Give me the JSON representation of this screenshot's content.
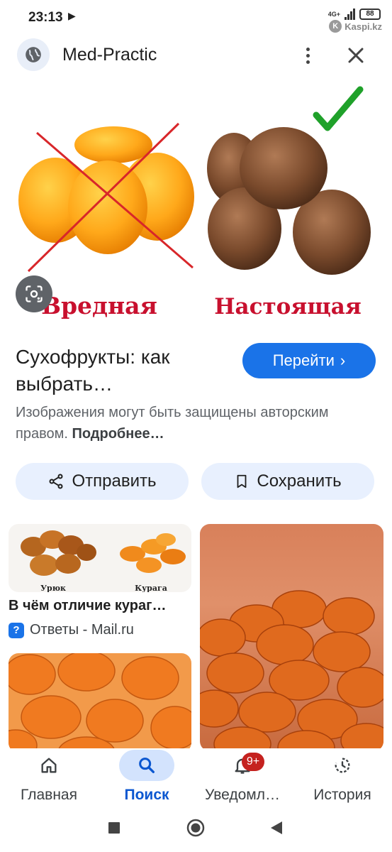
{
  "status_bar": {
    "time": "23:13",
    "network": "4G+",
    "battery": "88",
    "watermark": "Kaspi.kz"
  },
  "header": {
    "site_name": "Med-Practic",
    "site_icon": "globe-icon",
    "more_icon": "more-vert-icon",
    "close_icon": "close-icon"
  },
  "main_image": {
    "left_label": "Вредная",
    "right_label": "Настоящая"
  },
  "result": {
    "title_line1": "Сухофрукты: как",
    "title_line2": "выбрать…",
    "visit_label": "Перейти",
    "copyright_text": "Изображения могут быть защищены авторским правом.",
    "copyright_link": "Подробнее…"
  },
  "actions": {
    "share_label": "Отправить",
    "save_label": "Сохранить"
  },
  "related": {
    "card1": {
      "left_caption": "Урюк",
      "right_caption": "Курага",
      "title": "В чём отличие кураг…",
      "source": "Ответы - Mail.ru"
    }
  },
  "bottom_nav": {
    "items": [
      {
        "label": "Главная",
        "icon": "home-icon"
      },
      {
        "label": "Поиск",
        "icon": "search-icon"
      },
      {
        "label": "Уведомл…",
        "icon": "bell-icon",
        "badge": "9+"
      },
      {
        "label": "История",
        "icon": "history-icon"
      }
    ]
  },
  "colors": {
    "accent": "#1a73e8",
    "chip_bg": "#e8f0fe",
    "active_nav": "#d3e3fd",
    "label_red": "#c8102e",
    "badge": "#c5221f"
  }
}
